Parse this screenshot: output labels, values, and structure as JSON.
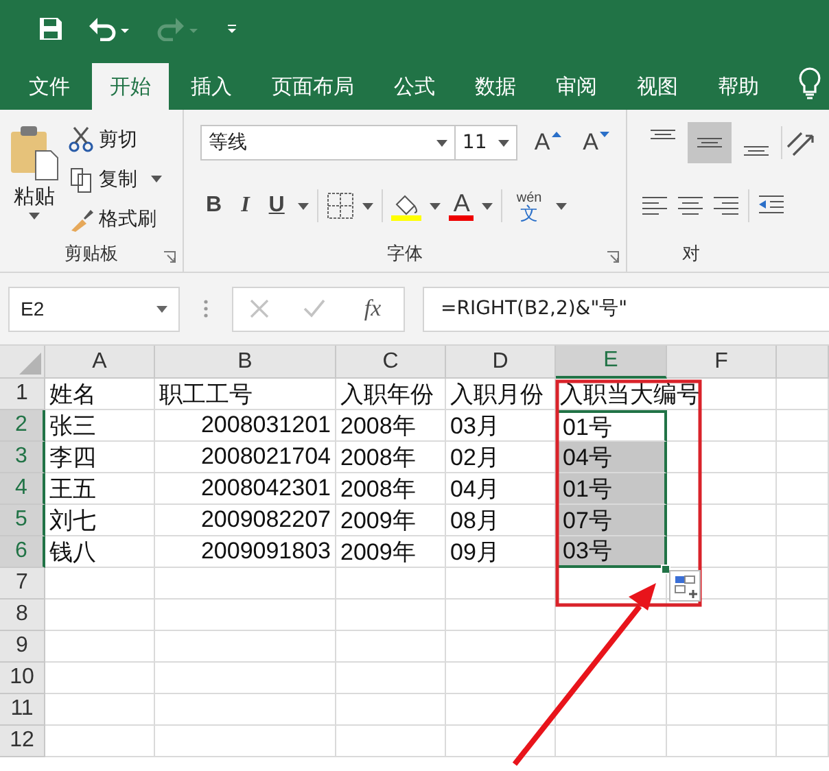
{
  "quick_access": [
    {
      "kind": "save",
      "disabled": false
    },
    {
      "kind": "undo",
      "disabled": false
    },
    {
      "kind": "redo",
      "disabled": true
    },
    {
      "kind": "customize",
      "disabled": false
    }
  ],
  "tabs": [
    {
      "label": "文件",
      "selected": false
    },
    {
      "label": "开始",
      "selected": true
    },
    {
      "label": "插入",
      "selected": false
    },
    {
      "label": "页面布局",
      "selected": false
    },
    {
      "label": "公式",
      "selected": false
    },
    {
      "label": "数据",
      "selected": false
    },
    {
      "label": "审阅",
      "selected": false
    },
    {
      "label": "视图",
      "selected": false
    },
    {
      "label": "帮助",
      "selected": false
    }
  ],
  "clipboard": {
    "label": "剪贴板",
    "paste": "粘贴",
    "cut": "剪切",
    "copy": "复制",
    "format_painter": "格式刷"
  },
  "font": {
    "label": "字体",
    "font_name": "等线",
    "font_size": "11",
    "grow": "A",
    "shrink": "A",
    "bold": "B",
    "italic": "I",
    "underline": "U",
    "font_color": "A",
    "phonetic": "wén",
    "phonetic_char": "文"
  },
  "alignment": {
    "label": "对",
    "vertical": [
      {
        "kind": "top",
        "selected": false
      },
      {
        "kind": "middle",
        "selected": true
      },
      {
        "kind": "bottom",
        "selected": false
      }
    ]
  },
  "formula_bar": {
    "name_box": "E2",
    "fx": "fx",
    "formula": "=RIGHT(B2,2)&\"号\""
  },
  "columns": [
    {
      "label": "A",
      "selected": false
    },
    {
      "label": "B",
      "selected": false
    },
    {
      "label": "C",
      "selected": false
    },
    {
      "label": "D",
      "selected": false
    },
    {
      "label": "E",
      "selected": true
    },
    {
      "label": "F",
      "selected": false
    }
  ],
  "rows": [
    {
      "label": "1",
      "selected": false,
      "cells": [
        {
          "text": "姓名"
        },
        {
          "text": "职工工号"
        },
        {
          "text": "入职年份"
        },
        {
          "text": "入职月份"
        },
        {
          "text": "入职当大编号"
        },
        {
          "text": ""
        }
      ]
    },
    {
      "label": "2",
      "selected": true,
      "cells": [
        {
          "text": "张三"
        },
        {
          "text": "2008031201",
          "numeric": true
        },
        {
          "text": "2008年"
        },
        {
          "text": "03月"
        },
        {
          "text": "01号",
          "selected": true,
          "active": true
        },
        {
          "text": ""
        }
      ]
    },
    {
      "label": "3",
      "selected": true,
      "cells": [
        {
          "text": "李四"
        },
        {
          "text": "2008021704",
          "numeric": true
        },
        {
          "text": "2008年"
        },
        {
          "text": "02月"
        },
        {
          "text": "04号",
          "selected": true
        },
        {
          "text": ""
        }
      ]
    },
    {
      "label": "4",
      "selected": true,
      "cells": [
        {
          "text": "王五"
        },
        {
          "text": "2008042301",
          "numeric": true
        },
        {
          "text": "2008年"
        },
        {
          "text": "04月"
        },
        {
          "text": "01号",
          "selected": true
        },
        {
          "text": ""
        }
      ]
    },
    {
      "label": "5",
      "selected": true,
      "cells": [
        {
          "text": "刘七"
        },
        {
          "text": "2009082207",
          "numeric": true
        },
        {
          "text": "2009年"
        },
        {
          "text": "08月"
        },
        {
          "text": "07号",
          "selected": true
        },
        {
          "text": ""
        }
      ]
    },
    {
      "label": "6",
      "selected": true,
      "cells": [
        {
          "text": "钱八"
        },
        {
          "text": "2009091803",
          "numeric": true
        },
        {
          "text": "2009年"
        },
        {
          "text": "09月"
        },
        {
          "text": "03号",
          "selected": true
        },
        {
          "text": ""
        }
      ]
    },
    {
      "label": "7",
      "selected": false,
      "cells": []
    },
    {
      "label": "8",
      "selected": false,
      "cells": []
    },
    {
      "label": "9",
      "selected": false,
      "cells": []
    },
    {
      "label": "10",
      "selected": false,
      "cells": []
    },
    {
      "label": "11",
      "selected": false,
      "cells": []
    },
    {
      "label": "12",
      "selected": false,
      "cells": []
    }
  ]
}
